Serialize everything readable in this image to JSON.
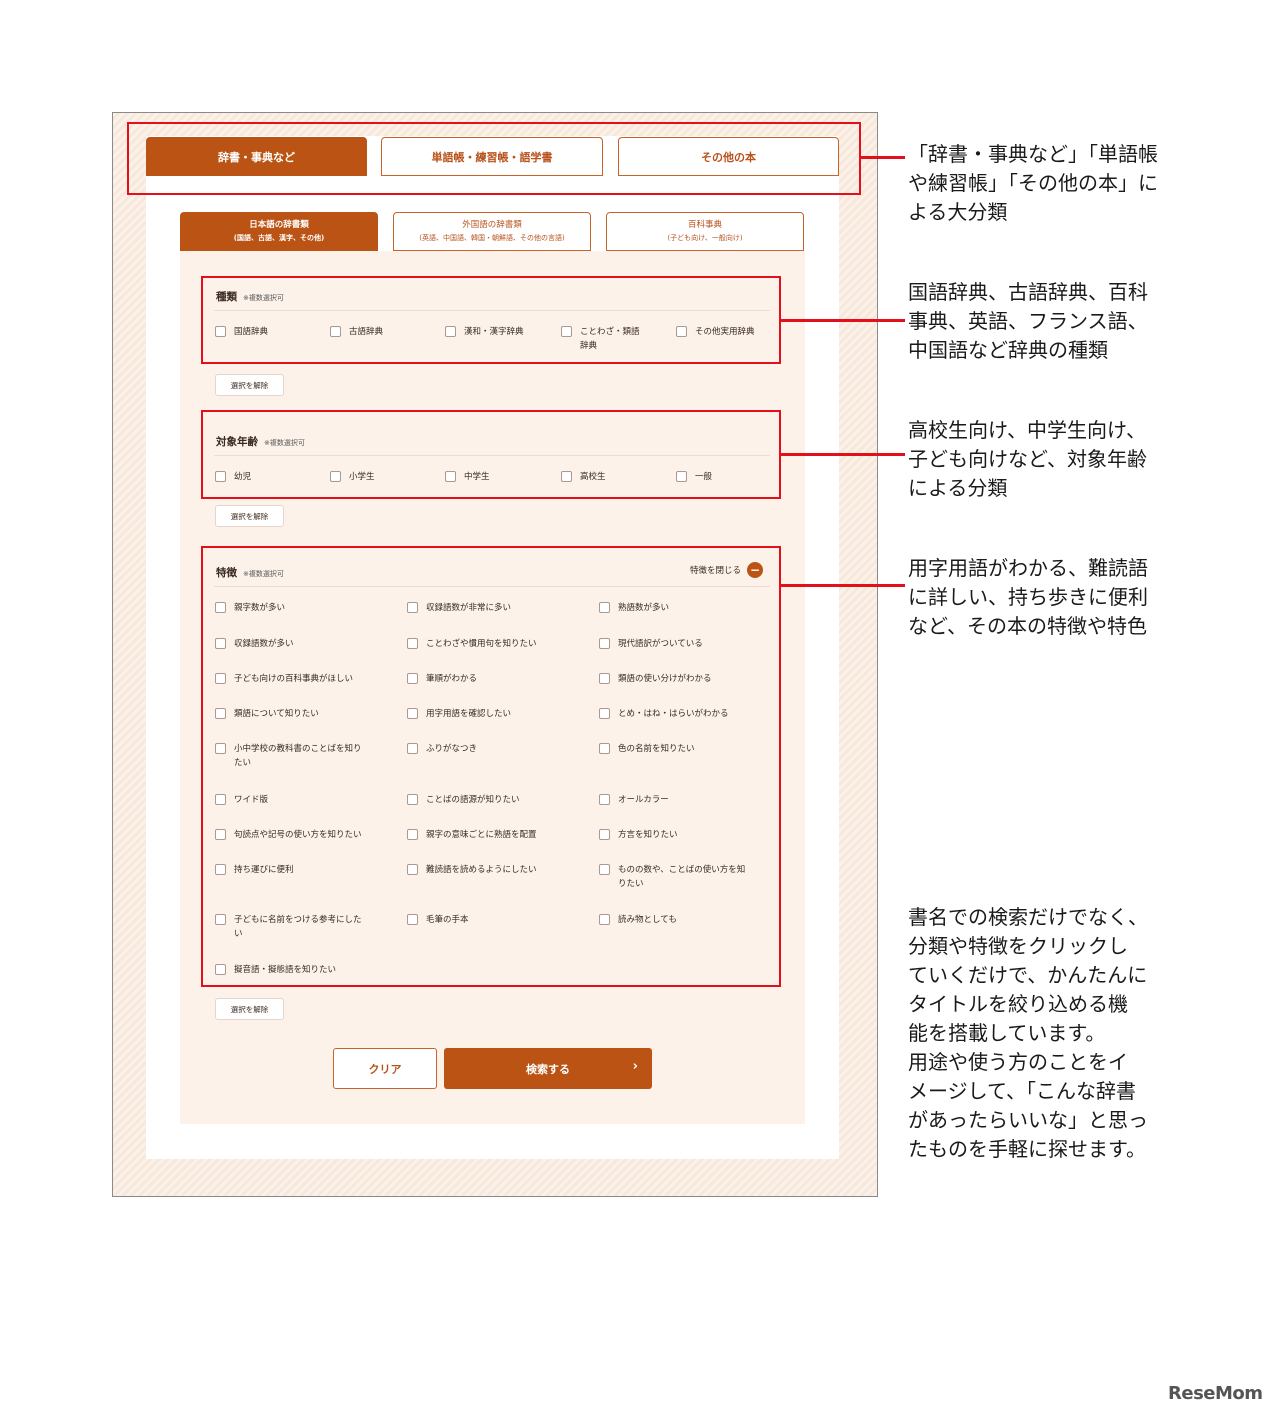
{
  "main_tabs": [
    {
      "label": "辞書・事典など",
      "active": true
    },
    {
      "label": "単語帳・練習帳・語学書",
      "active": false
    },
    {
      "label": "その他の本",
      "active": false
    }
  ],
  "sub_tabs": [
    {
      "label": "日本語の辞書類",
      "sub": "(国語、古語、漢字、その他)",
      "active": true
    },
    {
      "label": "外国語の辞書類",
      "sub": "(英語、中国語、韓国・朝鮮語、その他の言語)",
      "active": false
    },
    {
      "label": "百科事典",
      "sub": "(子ども向け、一般向け)",
      "active": false
    }
  ],
  "multi_select_note": "※複数選択可",
  "clear_selection_label": "選択を解除",
  "kind": {
    "title": "種類",
    "options": [
      "国語辞典",
      "古語辞典",
      "漢和・漢字辞典",
      "ことわざ・類語",
      "その他実用辞典"
    ],
    "option4_line2": "辞典"
  },
  "age": {
    "title": "対象年齢",
    "options": [
      "幼児",
      "小学生",
      "中学生",
      "高校生",
      "一般"
    ]
  },
  "features": {
    "title": "特徴",
    "close_label": "特徴を閉じる",
    "close_icon": "minus-circle-icon",
    "options": [
      [
        "親字数が多い",
        "収録語数が非常に多い",
        "熟語数が多い"
      ],
      [
        "収録語数が多い",
        "ことわざや慣用句を知りたい",
        "現代語訳がついている"
      ],
      [
        "子ども向けの百科事典がほしい",
        "筆順がわかる",
        "類語の使い分けがわかる"
      ],
      [
        "類語について知りたい",
        "用字用語を確認したい",
        "とめ・はね・はらいがわかる"
      ],
      [
        "小中学校の教科書のことばを知り",
        "ふりがなつき",
        "色の名前を知りたい"
      ],
      [
        "ワイド版",
        "ことばの語源が知りたい",
        "オールカラー"
      ],
      [
        "句読点や記号の使い方を知りたい",
        "親字の意味ごとに熟語を配置",
        "方言を知りたい"
      ],
      [
        "持ち運びに便利",
        "難読語を読めるようにしたい",
        "ものの数や、ことばの使い方を知"
      ],
      [
        "子どもに名前をつける参考にした",
        "毛筆の手本",
        "読み物としても"
      ],
      [
        "擬音語・擬態語を知りたい",
        "",
        ""
      ]
    ],
    "wraps": {
      "r4c0": "たい",
      "r7c2": "りたい",
      "r8c0": "い"
    }
  },
  "buttons": {
    "clear": "クリア",
    "search": "検索する",
    "search_arrow": "›"
  },
  "annotations": {
    "a1": [
      "「辞書・事典など」「単語帳",
      "や練習帳」「その他の本」に",
      "よる大分類"
    ],
    "a2": [
      "国語辞典、古語辞典、百科",
      "事典、英語、フランス語、",
      "中国語など辞典の種類"
    ],
    "a3": [
      "高校生向け、中学生向け、",
      "子ども向けなど、対象年齢",
      "による分類"
    ],
    "a4": [
      "用字用語がわかる、難読語",
      "に詳しい、持ち歩きに便利",
      "など、その本の特徴や特色"
    ],
    "a5": [
      "書名での検索だけでなく、",
      "分類や特徴をクリックし",
      "ていくだけで、かんたんに",
      "タイトルを絞り込める機",
      "能を搭載しています。",
      "用途や使う方のことをイ",
      "メージして、「こんな辞書",
      "があったらいいな」と思っ",
      "たものを手軽に探せます。"
    ]
  },
  "logo": "ReseMom",
  "colors": {
    "accent": "#ba5313",
    "annotation_red": "#e3101b",
    "panel": "#fcf2ea"
  }
}
